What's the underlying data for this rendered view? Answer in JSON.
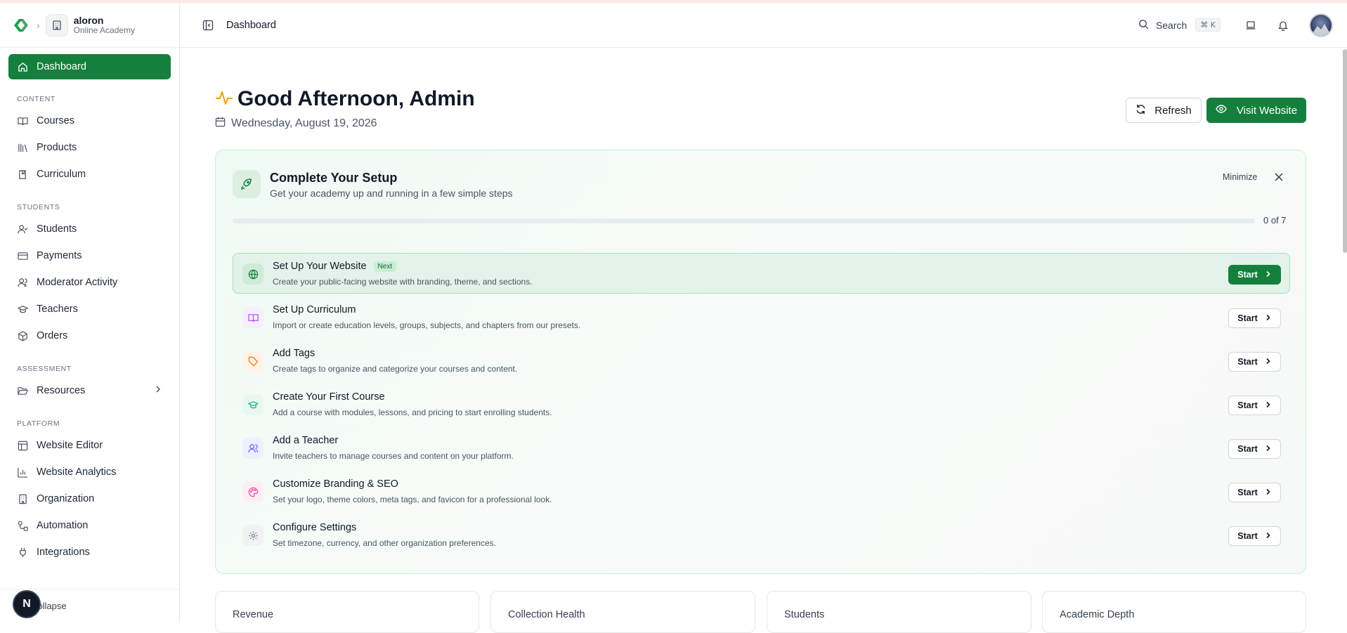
{
  "brand": {
    "org_name": "aloron",
    "org_sub": "Online Academy"
  },
  "sidebar": {
    "dashboard": "Dashboard",
    "sections": [
      {
        "label": "CONTENT",
        "items": [
          "Courses",
          "Products",
          "Curriculum"
        ]
      },
      {
        "label": "STUDENTS",
        "items": [
          "Students",
          "Payments",
          "Moderator Activity",
          "Teachers",
          "Orders"
        ]
      },
      {
        "label": "ASSESSMENT",
        "items": [
          "Resources"
        ]
      },
      {
        "label": "PLATFORM",
        "items": [
          "Website Editor",
          "Website Analytics",
          "Organization",
          "Automation",
          "Integrations"
        ]
      }
    ],
    "collapse": "Collapse",
    "n_badge": "N"
  },
  "header": {
    "title": "Dashboard",
    "search_label": "Search",
    "search_shortcut": "⌘ K"
  },
  "main": {
    "greeting": "Good Afternoon, Admin",
    "date": "Wednesday, August 19, 2026",
    "refresh": "Refresh",
    "visit_website": "Visit Website"
  },
  "setup": {
    "title": "Complete Your Setup",
    "subtitle": "Get your academy up and running in a few simple steps",
    "minimize": "Minimize",
    "progress_label": "0 of 7",
    "progress_fraction": 0,
    "next_badge": "Next",
    "start_label": "Start",
    "steps": [
      {
        "title": "Set Up Your Website",
        "desc": "Create your public-facing website with branding, theme, and sections.",
        "icon": "globe-icon",
        "color": "#15803d",
        "bg": "#cfead9"
      },
      {
        "title": "Set Up Curriculum",
        "desc": "Import or create education levels, groups, subjects, and chapters from our presets.",
        "icon": "book-open-icon",
        "color": "#a855f7",
        "bg": "#f5efff"
      },
      {
        "title": "Add Tags",
        "desc": "Create tags to organize and categorize your courses and content.",
        "icon": "tag-icon",
        "color": "#f97316",
        "bg": "#fff3e8"
      },
      {
        "title": "Create Your First Course",
        "desc": "Add a course with modules, lessons, and pricing to start enrolling students.",
        "icon": "graduation-cap-icon",
        "color": "#10b981",
        "bg": "#e8f8f1"
      },
      {
        "title": "Add a Teacher",
        "desc": "Invite teachers to manage courses and content on your platform.",
        "icon": "users-icon",
        "color": "#6366f1",
        "bg": "#eef0ff"
      },
      {
        "title": "Customize Branding & SEO",
        "desc": "Set your logo, theme colors, meta tags, and favicon for a professional look.",
        "icon": "palette-icon",
        "color": "#ec4899",
        "bg": "#fdeef6"
      },
      {
        "title": "Configure Settings",
        "desc": "Set timezone, currency, and other organization preferences.",
        "icon": "gear-icon",
        "color": "#6b7280",
        "bg": "#f1f2f4"
      }
    ]
  },
  "stats": [
    "Revenue",
    "Collection Health",
    "Students",
    "Academic Depth"
  ],
  "colors": {
    "accent": "#15803d",
    "greeting_icon": "#f59e0b"
  }
}
